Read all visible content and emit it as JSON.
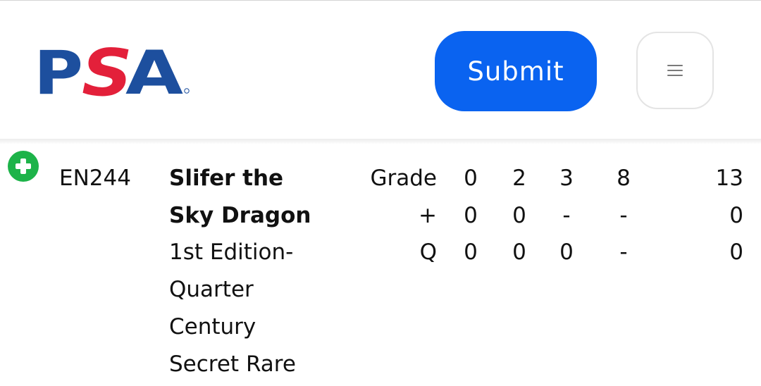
{
  "header": {
    "logo_text": "PSA",
    "submit_label": "Submit",
    "menu_icon": "hamburger-menu-icon"
  },
  "colors": {
    "brand_blue": "#1d4f9e",
    "brand_red": "#e3203a",
    "submit_blue": "#0a63f0",
    "add_green": "#1db349"
  },
  "card": {
    "add_icon": "plus-circle-icon",
    "set_code": "EN244",
    "name_lines": [
      "Slifer the",
      "Sky Dragon"
    ],
    "variant_lines": [
      "1st Edition-",
      "Quarter",
      "Century",
      "Secret Rare"
    ]
  },
  "population": {
    "rows": [
      {
        "label": "Grade",
        "values": [
          "0",
          "2",
          "3",
          "8",
          "13"
        ]
      },
      {
        "label": "+",
        "values": [
          "0",
          "0",
          "-",
          "-",
          "0"
        ]
      },
      {
        "label": "Q",
        "values": [
          "0",
          "0",
          "0",
          "-",
          "0"
        ]
      }
    ]
  }
}
